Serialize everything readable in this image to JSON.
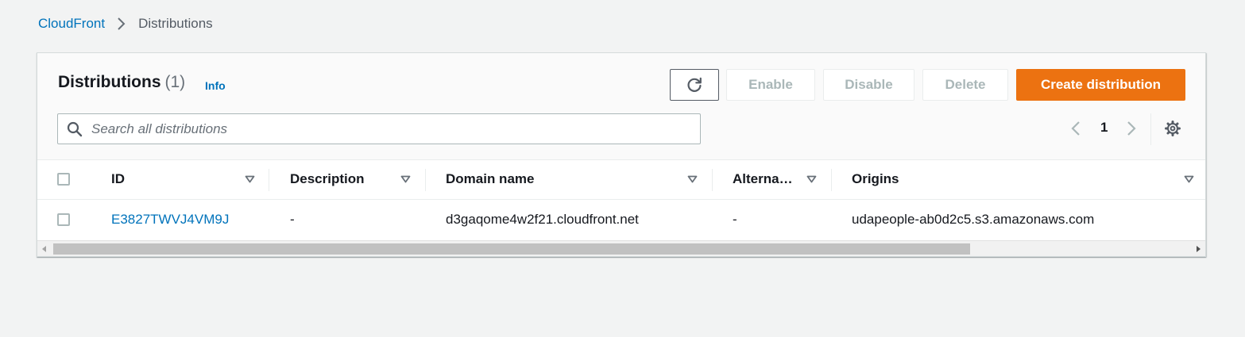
{
  "breadcrumb": {
    "root": "CloudFront",
    "current": "Distributions"
  },
  "header": {
    "title": "Distributions",
    "count": "(1)",
    "info": "Info"
  },
  "actions": {
    "enable": "Enable",
    "disable": "Disable",
    "delete": "Delete",
    "create": "Create distribution"
  },
  "search": {
    "placeholder": "Search all distributions",
    "value": ""
  },
  "pagination": {
    "current_page": "1"
  },
  "table": {
    "columns": [
      "ID",
      "Description",
      "Domain name",
      "Alterna…",
      "Origins"
    ],
    "rows": [
      {
        "id": "E3827TWVJ4VM9J",
        "description": "-",
        "domain_name": "d3gaqome4w2f21.cloudfront.net",
        "alternate": "-",
        "origins": "udapeople-ab0d2c5.s3.amazonaws.com"
      }
    ]
  },
  "colors": {
    "accent": "#ec7211",
    "link": "#0073bb",
    "background": "#f2f3f3"
  }
}
